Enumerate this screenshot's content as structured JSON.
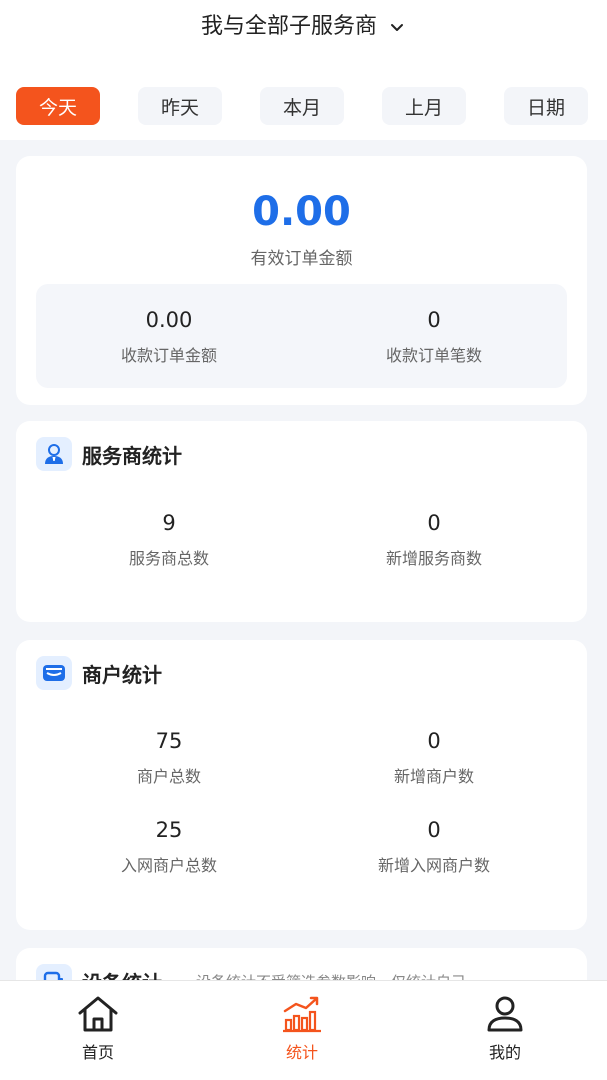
{
  "header": {
    "title": "我与全部子服务商",
    "tabs": [
      "今天",
      "昨天",
      "本月",
      "上月",
      "日期"
    ],
    "active_tab": 0
  },
  "summary": {
    "main_value": "0.00",
    "main_label": "有效订单金额",
    "stats": [
      {
        "value": "0.00",
        "label": "收款订单金额"
      },
      {
        "value": "0",
        "label": "收款订单笔数"
      }
    ]
  },
  "provider_stats": {
    "title": "服务商统计",
    "icon": "user-suit-icon",
    "stats": [
      {
        "value": "9",
        "label": "服务商总数"
      },
      {
        "value": "0",
        "label": "新增服务商数"
      }
    ]
  },
  "merchant_stats": {
    "title": "商户统计",
    "icon": "store-icon",
    "stats": [
      {
        "value": "75",
        "label": "商户总数"
      },
      {
        "value": "0",
        "label": "新增商户数"
      },
      {
        "value": "25",
        "label": "入网商户总数"
      },
      {
        "value": "0",
        "label": "新增入网商户数"
      }
    ]
  },
  "device_stats": {
    "title": "设备统计",
    "note": "设备统计不受筛选参数影响，仅统计自己",
    "icon": "device-icon"
  },
  "bottom_nav": {
    "items": [
      {
        "label": "首页",
        "icon": "home-icon"
      },
      {
        "label": "统计",
        "icon": "chart-icon"
      },
      {
        "label": "我的",
        "icon": "profile-icon"
      }
    ],
    "active": 1
  },
  "colors": {
    "accent": "#f4541d",
    "value_blue": "#1e6ee8",
    "page_bg": "#f3f5f9"
  }
}
